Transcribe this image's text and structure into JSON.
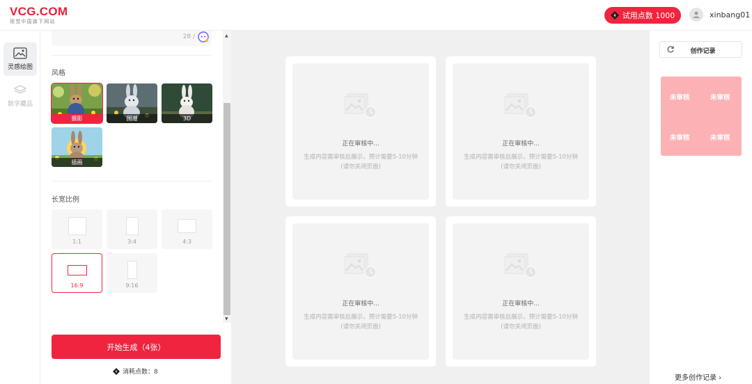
{
  "header": {
    "logo_main": "VCG.COM",
    "logo_sub": "视觉中国旗下网站",
    "trial_label": "试用点数 1000",
    "username": "xinbang01",
    "brand_color": "#f0243f"
  },
  "nav": {
    "items": [
      {
        "label": "灵感绘图",
        "icon": "image-icon",
        "active": true
      },
      {
        "label": "数字藏品",
        "icon": "layers-icon",
        "active": false
      }
    ]
  },
  "panel": {
    "counter": "28 /",
    "style_title": "风格",
    "styles": [
      {
        "label": "摄影",
        "selected": true
      },
      {
        "label": "国潮",
        "selected": false
      },
      {
        "label": "3D",
        "selected": false
      },
      {
        "label": "插画",
        "selected": false
      }
    ],
    "ratio_title": "长宽比例",
    "ratios": [
      {
        "label": "1:1",
        "selected": false
      },
      {
        "label": "3:4",
        "selected": false
      },
      {
        "label": "4:3",
        "selected": false
      },
      {
        "label": "16:9",
        "selected": true
      },
      {
        "label": "9:16",
        "selected": false
      }
    ],
    "generate_label": "开始生成（4张）",
    "cost_label": "消耗点数：8"
  },
  "results": [
    {
      "status": "正在审核中...",
      "desc": "生成内容需审核后展示，预计需要5-10分钟",
      "note": "(请勿关闭页面)"
    },
    {
      "status": "正在审核中...",
      "desc": "生成内容需审核后展示，预计需要5-10分钟",
      "note": "(请勿关闭页面)"
    },
    {
      "status": "正在审核中...",
      "desc": "生成内容需审核后展示，预计需要5-10分钟",
      "note": "(请勿关闭页面)"
    },
    {
      "status": "正在审核中...",
      "desc": "生成内容需审核后展示，预计需要5-10分钟",
      "note": "(请勿关闭页面)"
    }
  ],
  "history": {
    "title": "创作记录",
    "thumbs": [
      "未审核",
      "未审核",
      "未审核",
      "未审核"
    ],
    "more_label": "更多创作记录 ›"
  }
}
